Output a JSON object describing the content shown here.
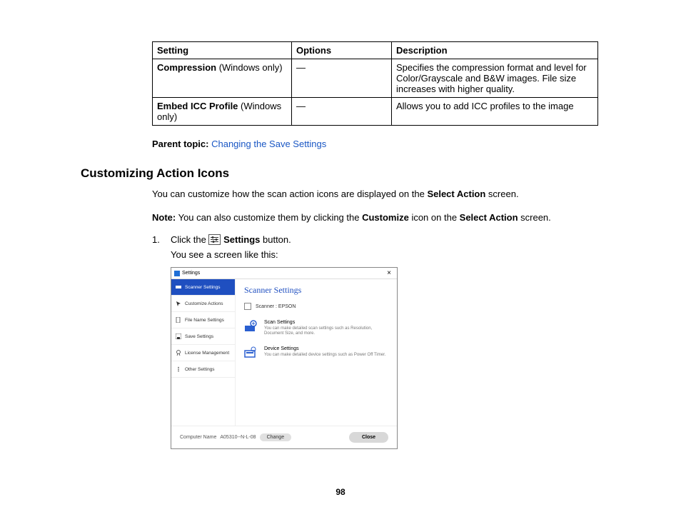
{
  "table": {
    "headers": {
      "setting": "Setting",
      "options": "Options",
      "description": "Description"
    },
    "rows": [
      {
        "setting_bold": "Compression",
        "setting_rest": " (Windows only)",
        "options": "—",
        "description": "Specifies the compression format and level for Color/Grayscale and B&W images. File size increases with higher quality."
      },
      {
        "setting_bold": "Embed ICC Profile",
        "setting_rest": " (Windows only)",
        "options": "—",
        "description": "Allows you to add ICC profiles to the image"
      }
    ]
  },
  "parent_topic": {
    "label": "Parent topic:",
    "link": "Changing the Save Settings"
  },
  "heading": "Customizing Action Icons",
  "intro": {
    "pre": "You can customize how the scan action icons are displayed on the ",
    "bold1": "Select Action",
    "post": " screen."
  },
  "note": {
    "label": "Note:",
    "t1": " You can also customize them by clicking the ",
    "b1": "Customize",
    "t2": " icon on the ",
    "b2": "Select Action",
    "t3": " screen."
  },
  "step1": {
    "num": "1.",
    "pre": "Click the ",
    "bold": "Settings",
    "post": " button."
  },
  "step1_result": "You see a screen like this:",
  "screenshot": {
    "titlebar": "Settings",
    "close": "×",
    "nav": [
      {
        "label": "Scanner Settings"
      },
      {
        "label": "Customize Actions"
      },
      {
        "label": "File Name Settings"
      },
      {
        "label": "Save Settings"
      },
      {
        "label": "License Management"
      },
      {
        "label": "Other Settings"
      }
    ],
    "main_title": "Scanner Settings",
    "scanner_label": "Scanner :  EPSON",
    "blocks": [
      {
        "title": "Scan Settings",
        "desc": "You can make detailed scan settings such as Resolution, Document Size, and more."
      },
      {
        "title": "Device Settings",
        "desc": "You can make detailed device settings such as Power Off Timer."
      }
    ],
    "footer": {
      "label": "Computer Name",
      "value": "A05310--N-L-08",
      "change": "Change",
      "close": "Close"
    }
  },
  "page_number": "98"
}
